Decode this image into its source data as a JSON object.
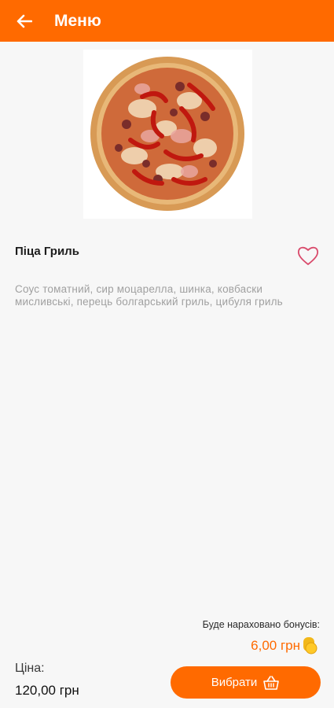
{
  "appbar": {
    "title": "Меню",
    "back_icon": "arrow-left-icon"
  },
  "product": {
    "name": "Піца Гриль",
    "description": "Соус томатний, сир моцарелла, шинка, ковбаски мисливські, перець болгарський гриль, цибуля гриль",
    "image_icon": "pizza-image",
    "favorite_icon": "heart-outline-icon"
  },
  "bonus": {
    "label": "Буде нараховано бонусів:",
    "value": "6,00 грн",
    "icon": "coins-icon"
  },
  "price": {
    "label": "Ціна:",
    "value": "120,00 грн"
  },
  "actions": {
    "choose_label": "Вибрати",
    "choose_icon": "basket-icon"
  },
  "colors": {
    "accent": "#ff6a00",
    "background": "#f7f7f7",
    "description_text": "#a0a0a0"
  }
}
